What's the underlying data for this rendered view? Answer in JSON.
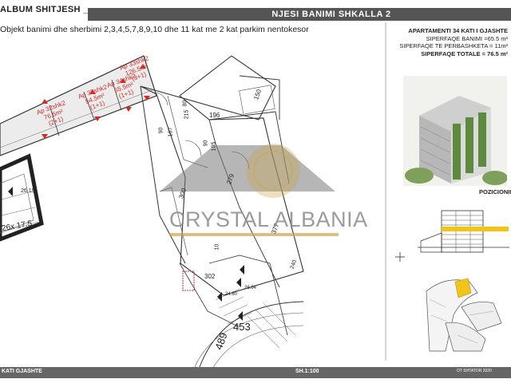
{
  "header": {
    "album": "ALBUM SHITJESH ___",
    "title": "NJESI BANIMI  SHKALLA 2",
    "description": "Objekt banimi dhe sherbimi 2,3,4,5,7,8,9,10 dhe 11 kat me 2 kat parkim nentokesor"
  },
  "apartment_info": {
    "title": "APARTAMENTI 34 KATI I GJASHTE",
    "living_area": "SIPERFAQE BANIMI =65.5 m²",
    "shared_area": "SIPERFAQE TE PERBASHKETA = 11m²",
    "total_area": "SIPERFAQE TOTALE = 76.5 m²"
  },
  "positioning_label": "POZICIONIM",
  "watermark": "CRYSTAL ALBANIA",
  "units": [
    {
      "label": "Ap 32shk2",
      "area": "76.5m²",
      "type": "(2+1)"
    },
    {
      "label": "Ap 35shk2",
      "area": "54.5m²",
      "type": "(1+1)"
    },
    {
      "label": "Ap 34shk2",
      "area": "65.5m²",
      "type": "(1+1)"
    },
    {
      "label": "Ap 33shk2",
      "area": "126.5m²",
      "type": "(3+1)"
    }
  ],
  "dimensions": [
    "150",
    "196",
    "80",
    "215",
    "90",
    "167",
    "90",
    "105",
    "279",
    "300",
    "377",
    "302",
    "240",
    "10",
    "453",
    "489",
    "26.19",
    "26x 17.5",
    "26.64",
    "24.60"
  ],
  "footer": {
    "floor": "KATI GJASHTE",
    "scale": "SH.1:100",
    "date": "OT SHTATOR 2020"
  },
  "colors": {
    "header_band": "#555555",
    "red_markers": "#d22b2b",
    "footer_band": "#666666"
  }
}
